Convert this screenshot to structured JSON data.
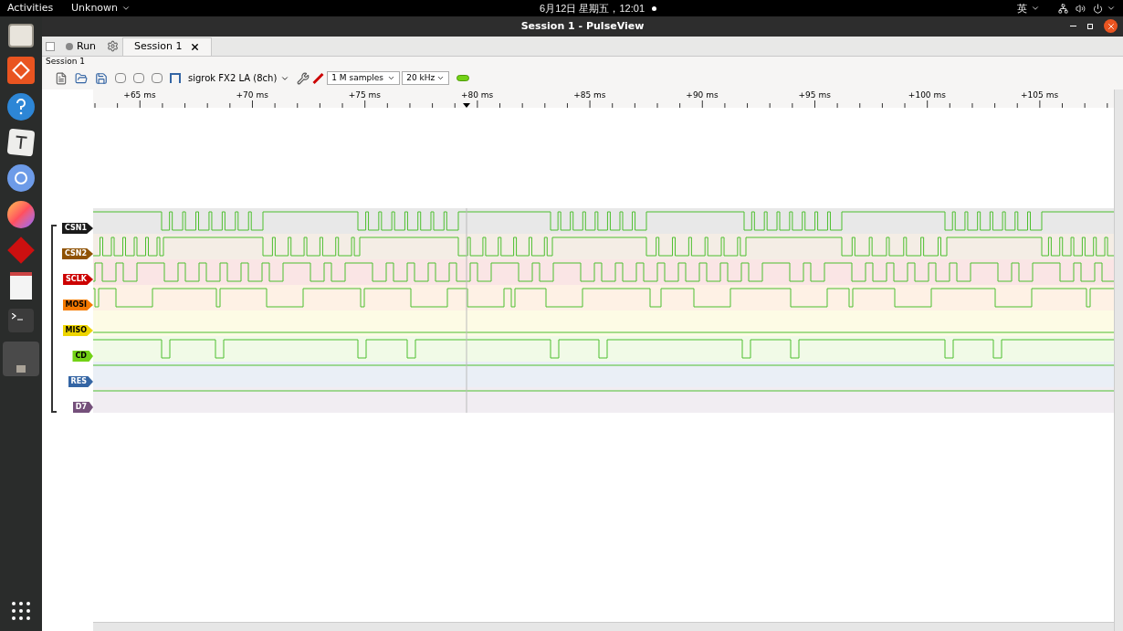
{
  "top_bar": {
    "activities": "Activities",
    "app_menu": "Unknown",
    "clock": "6月12日 星期五，12:01",
    "input_method": "英"
  },
  "window": {
    "title": "Session 1 - PulseView"
  },
  "tabs": [
    {
      "label": "Run",
      "kind": "button",
      "selected": false
    },
    {
      "label": "Session 1",
      "kind": "session",
      "selected": true
    }
  ],
  "session_label": "Session 1",
  "toolbar": {
    "device": "sigrok FX2 LA (8ch)",
    "samples": "1 M samples",
    "samplerate": "20 kHz"
  },
  "ruler": {
    "ticks": [
      "+65 ms",
      "+70 ms",
      "+75 ms",
      "+80 ms",
      "+85 ms",
      "+90 ms",
      "+95 ms",
      "+100 ms",
      "+105 ms"
    ]
  },
  "channels": [
    {
      "name": "CSN1",
      "color": "#1a1a1a"
    },
    {
      "name": "CSN2",
      "color": "#8f5202"
    },
    {
      "name": "SCLK",
      "color": "#cc0000"
    },
    {
      "name": "MOSI",
      "color": "#f57900"
    },
    {
      "name": "MISO",
      "color": "#edd400"
    },
    {
      "name": "CD",
      "color": "#73d216"
    },
    {
      "name": "RES",
      "color": "#3465a4"
    },
    {
      "name": "D7",
      "color": "#75507b"
    }
  ]
}
